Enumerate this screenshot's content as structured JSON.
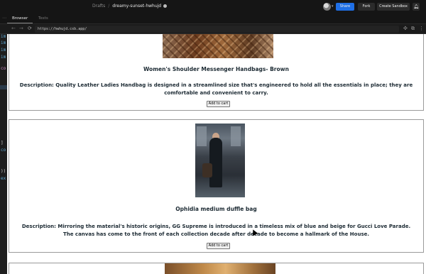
{
  "header": {
    "breadcrumb_root": "Drafts",
    "breadcrumb_sep": "/",
    "sandbox_name": "dreamy-sunset-hwhujd",
    "share_label": "Share",
    "fork_label": "Fork",
    "create_sandbox_label": "Create Sandbox",
    "accent_color": "#1f6fe6"
  },
  "tabs": [
    {
      "label": "Browser",
      "active": true
    },
    {
      "label": "Tests",
      "active": false
    }
  ],
  "url_bar": {
    "url": "https://hwhujd.csb.app/"
  },
  "products": [
    {
      "title": "Women's Shoulder Messenger Handbags- Brown",
      "description": "Description: Quality Leather Ladies Handbag is designed in a streamlined size that's engineered to hold all the essentials in place; they are comfortable and convenient to carry.",
      "button_label": "Add to cart"
    },
    {
      "title": "Ophidia medium duffle bag",
      "description": "Description: Mirroring the material's historic origins, GG Supreme is introduced in a timeless mix of blue and beige for Gucci Love Parade. The canvas has come to the front of each collection decade after decade to become a hallmark of the House.",
      "button_label": "Add to cart"
    }
  ],
  "icons": {
    "reload": "reload-icon",
    "back": "back-arrow-icon",
    "forward": "forward-arrow-icon",
    "bell": "bell-icon",
    "open_new": "open-in-new-window-icon"
  }
}
